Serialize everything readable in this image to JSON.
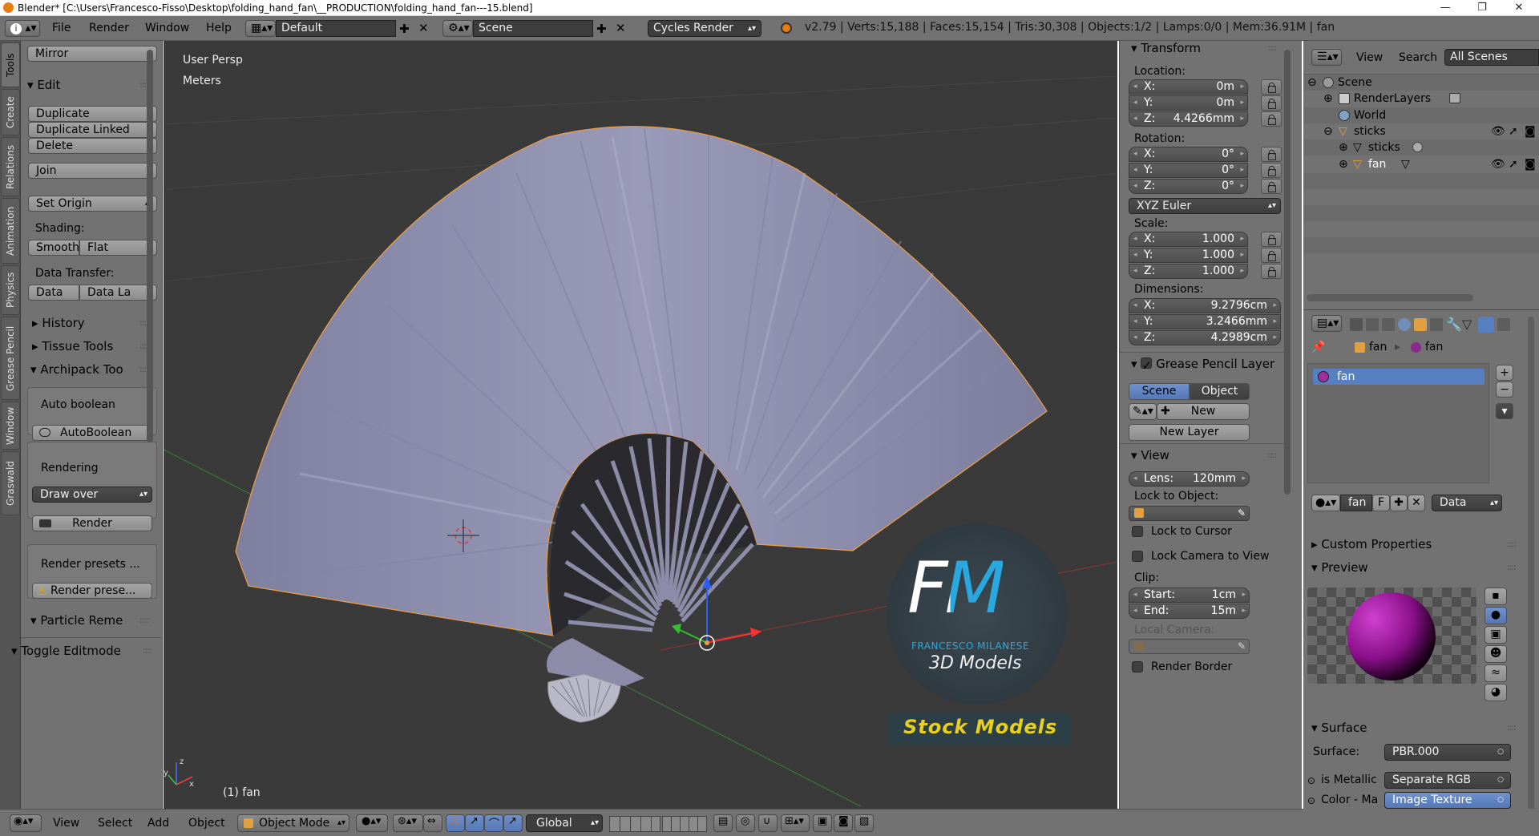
{
  "titlebar": {
    "title": "Blender* [C:\\Users\\Francesco-Fisso\\Desktop\\folding_hand_fan\\__PRODUCTION\\folding_hand_fan---15.blend]",
    "minimize": "—",
    "maximize": "❐",
    "close": "✕"
  },
  "header": {
    "menus": [
      "File",
      "Render",
      "Window",
      "Help"
    ],
    "layout": "Default",
    "scene": "Scene",
    "engine": "Cycles Render",
    "stats": "v2.79 | Verts:15,188 | Faces:15,154 | Tris:30,308 | Objects:1/2 | Lamps:0/0 | Mem:36.91M | fan"
  },
  "tabs": [
    "Tools",
    "Create",
    "Relations",
    "Animation",
    "Physics",
    "Grease Pencil",
    "Window",
    "Graswald"
  ],
  "toolshelf": {
    "mirror": "Mirror",
    "edit_panel": "Edit",
    "duplicate": "Duplicate",
    "duplicate_linked": "Duplicate Linked",
    "delete": "Delete",
    "join": "Join",
    "set_origin": "Set Origin",
    "shading_label": "Shading:",
    "smooth": "Smooth",
    "flat": "Flat",
    "data_transfer_label": "Data Transfer:",
    "data": "Data",
    "data_la": "Data La",
    "history": "History",
    "tissue_tools": "Tissue Tools",
    "archipack_tools": "Archipack Too",
    "auto_boolean_label": "Auto boolean",
    "autoboolean_btn": "AutoBoolean",
    "rendering_label": "Rendering",
    "draw_over": "Draw over",
    "render": "Render",
    "render_presets": "Render presets ...",
    "render_prese_btn": "Render prese...",
    "particle_remesh": "Particle Reme",
    "toggle_editmode": "Toggle Editmode"
  },
  "viewport": {
    "view_name": "User Persp",
    "units": "Meters",
    "object_label": "(1) fan",
    "watermark": {
      "letters": "FM",
      "name": "FRANCESCO MILANESE",
      "subtitle": "3D Models",
      "banner": "Stock Models"
    }
  },
  "npanel": {
    "transform": "Transform",
    "location_label": "Location:",
    "location": [
      {
        "k": "X:",
        "v": "0m"
      },
      {
        "k": "Y:",
        "v": "0m"
      },
      {
        "k": "Z:",
        "v": "4.4266mm"
      }
    ],
    "rotation_label": "Rotation:",
    "rotation": [
      {
        "k": "X:",
        "v": "0°"
      },
      {
        "k": "Y:",
        "v": "0°"
      },
      {
        "k": "Z:",
        "v": "0°"
      }
    ],
    "rotation_mode": "XYZ Euler",
    "scale_label": "Scale:",
    "scale": [
      {
        "k": "X:",
        "v": "1.000"
      },
      {
        "k": "Y:",
        "v": "1.000"
      },
      {
        "k": "Z:",
        "v": "1.000"
      }
    ],
    "dimensions_label": "Dimensions:",
    "dimensions": [
      {
        "k": "X:",
        "v": "9.2796cm"
      },
      {
        "k": "Y:",
        "v": "3.2466mm"
      },
      {
        "k": "Z:",
        "v": "4.2989cm"
      }
    ],
    "grease_pencil": "Grease Pencil Layer",
    "scene_btn": "Scene",
    "object_btn": "Object",
    "new_btn": "New",
    "new_layer": "New Layer",
    "view": "View",
    "lens": {
      "k": "Lens:",
      "v": "120mm"
    },
    "lock_to_object": "Lock to Object:",
    "lock_to_cursor": "Lock to Cursor",
    "lock_camera": "Lock Camera to View",
    "clip_label": "Clip:",
    "clip_start": {
      "k": "Start:",
      "v": "1cm"
    },
    "clip_end": {
      "k": "End:",
      "v": "15m"
    },
    "local_camera": "Local Camera:",
    "render_border": "Render Border"
  },
  "outliner": {
    "view": "View",
    "search": "Search",
    "filter": "All Scenes",
    "items": [
      {
        "label": "Scene"
      },
      {
        "label": "RenderLayers"
      },
      {
        "label": "World"
      },
      {
        "label": "sticks"
      },
      {
        "label": "sticks"
      },
      {
        "label": "fan"
      }
    ]
  },
  "properties": {
    "breadcrumb_object": "fan",
    "breadcrumb_material": "fan",
    "slot": "fan",
    "material_name": "fan",
    "fake_user": "F",
    "link": "Data",
    "custom_properties": "Custom Properties",
    "preview": "Preview",
    "surface_panel": "Surface",
    "surface_label": "Surface:",
    "surface_value": "PBR.000",
    "is_metallic_label": "is Metallic",
    "is_metallic_value": "Separate RGB",
    "color_label": "Color - Ma",
    "color_value": "Image Texture"
  },
  "bottombar": {
    "menus": [
      "View",
      "Select",
      "Add",
      "Object"
    ],
    "mode": "Object Mode",
    "orientation": "Global"
  },
  "colors": {
    "ui_gray": "#727272",
    "viewport_bg": "#3a3a3a",
    "selection_blue": "#5680c2",
    "fan_fabric": "#8a8aa8",
    "outline_orange": "#f0a040",
    "watermark_blue": "#29a8e0",
    "banner_yellow": "#e8d020"
  }
}
